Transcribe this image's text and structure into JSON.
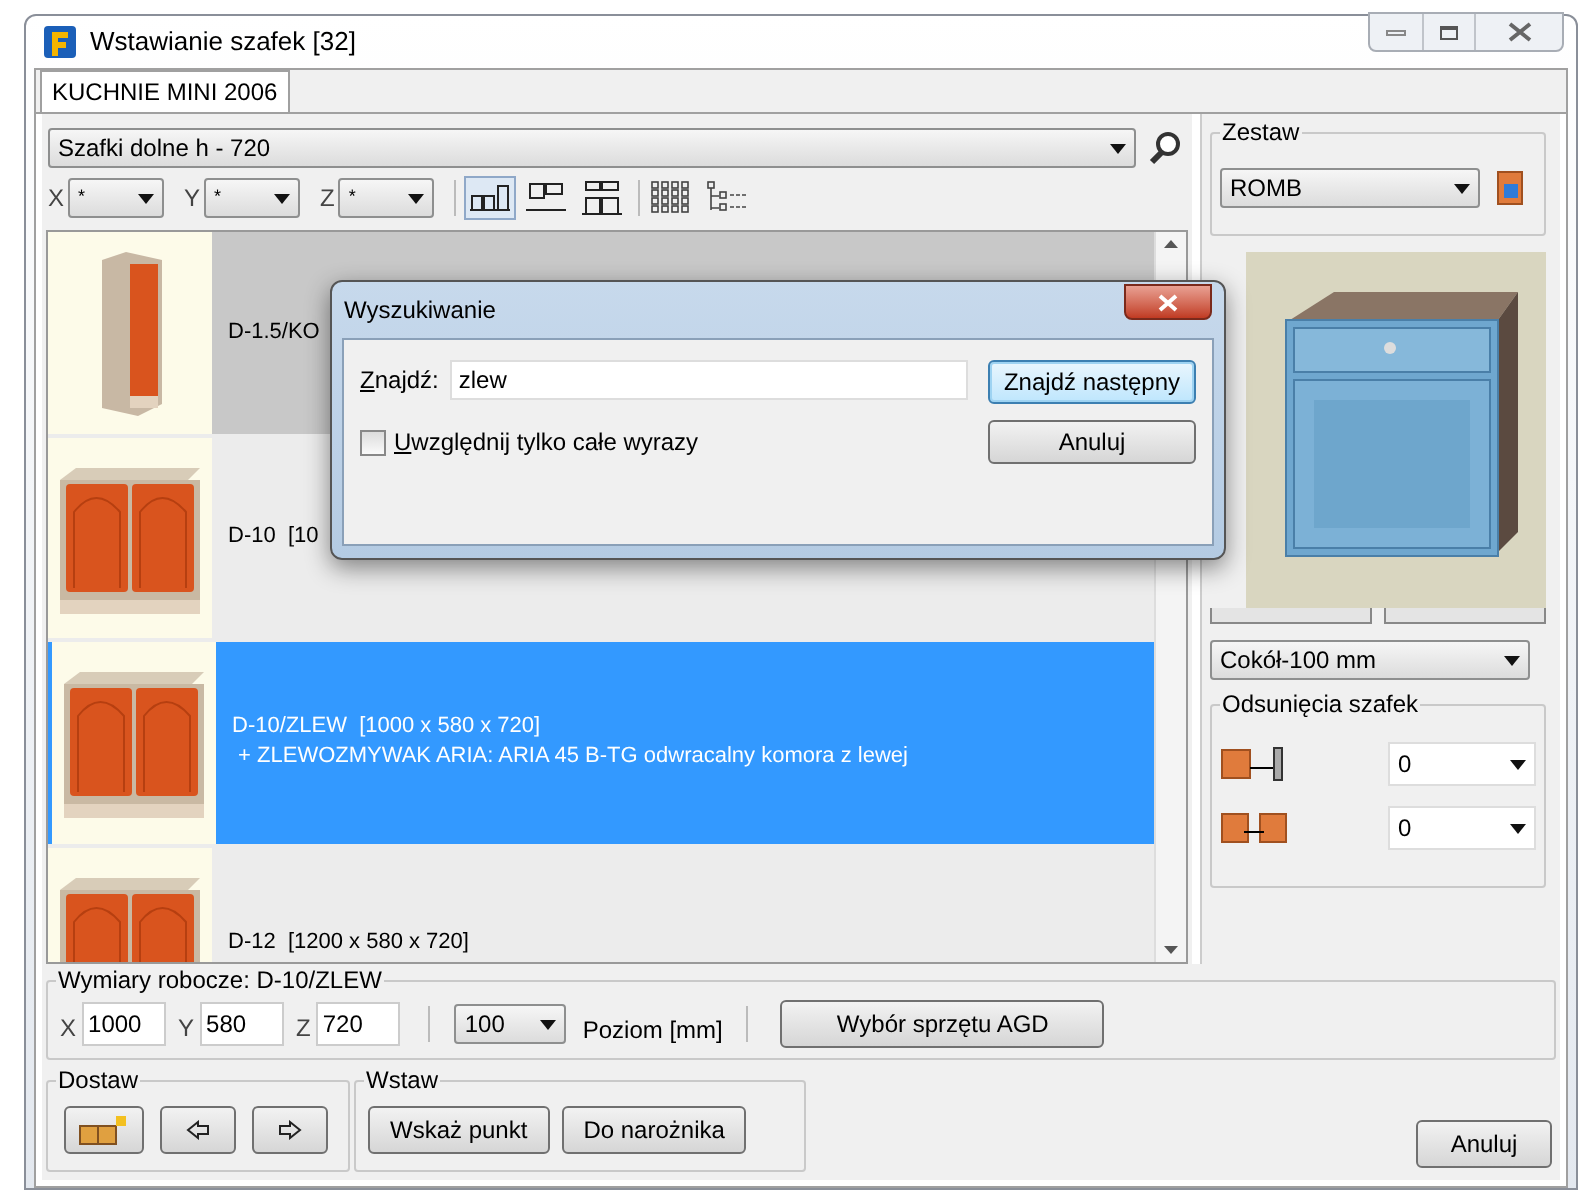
{
  "window": {
    "title": "Wstawianie szafek [32]"
  },
  "tabs": [
    {
      "label": "KUCHNIE MINI 2006",
      "selected": true
    }
  ],
  "category": {
    "value": "Szafki dolne h - 720"
  },
  "filters": [
    {
      "label": "X",
      "value": "*"
    },
    {
      "label": "Y",
      "value": "*"
    },
    {
      "label": "Z",
      "value": "*"
    }
  ],
  "view_buttons": [
    {
      "kind": "front",
      "selected": true
    },
    {
      "kind": "top",
      "selected": false
    },
    {
      "kind": "both",
      "selected": false
    }
  ],
  "items": [
    {
      "kind": "narrow",
      "label": "D-1.5/KO",
      "selected": false,
      "hovered": true
    },
    {
      "kind": "double",
      "label": "D-10  [10",
      "selected": false,
      "hovered": false
    },
    {
      "kind": "double",
      "label": "D-10/ZLEW  [1000 x 580 x 720]",
      "details": "+ ZLEWOZMYWAK ARIA: ARIA 45 B-TG odwracalny komora z lewej",
      "selected": true,
      "hovered": false
    },
    {
      "kind": "double",
      "label": "D-12  [1200 x 580 x 720]",
      "selected": false,
      "hovered": false
    }
  ],
  "set": {
    "title": "Zestaw",
    "value": "ROMB"
  },
  "plinth": {
    "value": "Cokół-100 mm"
  },
  "offsets": {
    "title": "Odsunięcia szafek",
    "rows": [
      {
        "kind": "wall",
        "value": "0"
      },
      {
        "kind": "cabinet",
        "value": "0"
      }
    ]
  },
  "dimensions": {
    "title": "Wymiary robocze: D-10/ZLEW",
    "fields": [
      {
        "label": "X",
        "value": "1000"
      },
      {
        "label": "Y",
        "value": "580"
      },
      {
        "label": "Z",
        "value": "720"
      }
    ],
    "level_value": "100",
    "level_label": "Poziom [mm]",
    "appliance_button": "Wybór sprzętu AGD"
  },
  "dostaw": {
    "title": "Dostaw"
  },
  "wstaw": {
    "title": "Wstaw",
    "buttons": [
      "Wskaż punkt",
      "Do narożnika"
    ]
  },
  "cancel_button": "Anuluj",
  "search_dialog": {
    "title": "Wyszukiwanie",
    "find_label": "Znajdź:",
    "query": "zlew",
    "whole_words": {
      "label": "Uwzględnij tylko całe wyrazy",
      "checked": false
    },
    "buttons": [
      {
        "label": "Znajdź następny",
        "default": true
      },
      {
        "label": "Anuluj",
        "default": false
      }
    ]
  }
}
